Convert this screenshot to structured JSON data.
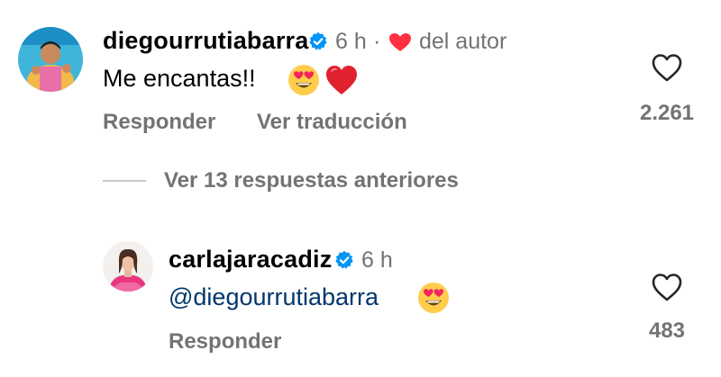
{
  "comment": {
    "username": "diegourrutiabarra",
    "time": "6 h",
    "separator": "·",
    "author_label": "del autor",
    "text": "Me encantas!!",
    "emojis": [
      "heart-eyes-emoji",
      "red-heart-emoji"
    ],
    "reply_label": "Responder",
    "translate_label": "Ver traducción",
    "like_count": "2.261"
  },
  "replies_toggle": {
    "label": "Ver 13 respuestas anteriores"
  },
  "reply": {
    "username": "carlajaracadiz",
    "time": "6 h",
    "mention": "@diegourrutiabarra",
    "emojis": [
      "heart-eyes-emoji"
    ],
    "reply_label": "Responder",
    "like_count": "483"
  },
  "colors": {
    "secondary_text": "#737373",
    "mention_link": "#00376b",
    "verified_badge": "#0095f6",
    "heart_red": "#ff3040"
  }
}
